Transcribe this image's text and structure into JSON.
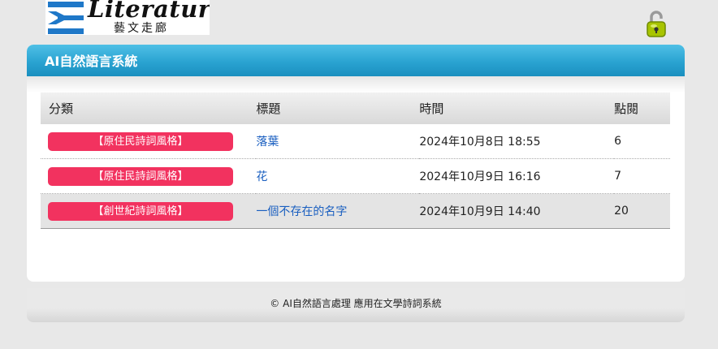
{
  "header": {
    "logo_word": "Literature",
    "logo_sub": "藝文走廊"
  },
  "panel": {
    "title": "AI自然語言系統"
  },
  "table": {
    "columns": [
      "分類",
      "標題",
      "時間",
      "點閱"
    ],
    "rows": [
      {
        "category": "【原住民詩詞風格】",
        "title": "落葉",
        "time": "2024年10月8日 18:55",
        "views": "6"
      },
      {
        "category": "【原住民詩詞風格】",
        "title": "花",
        "time": "2024年10月9日 16:16",
        "views": "7"
      },
      {
        "category": "【創世紀詩詞風格】",
        "title": "一個不存在的名字",
        "time": "2024年10月9日 14:40",
        "views": "20"
      }
    ]
  },
  "footer": {
    "text": "© AI自然語言處理 應用在文學詩詞系統"
  },
  "colors": {
    "header_blue": "#2aa3d1",
    "badge_pink": "#f2325f",
    "link_blue": "#1a5fc0"
  },
  "icons": {
    "logo_mark": "sigma-logo-icon",
    "lock": "lock-icon"
  }
}
